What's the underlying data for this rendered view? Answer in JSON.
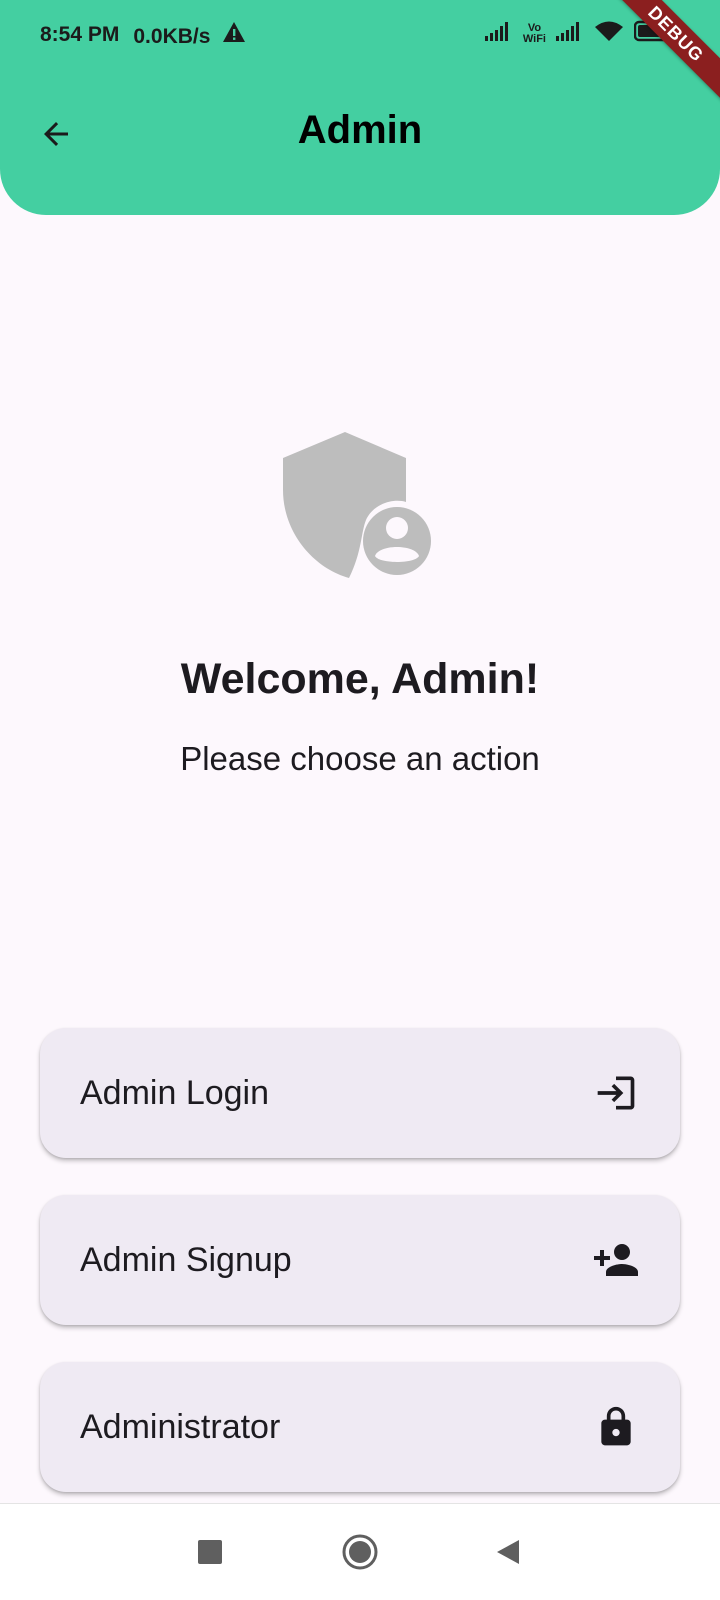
{
  "status_bar": {
    "time": "8:54 PM",
    "network_speed": "0.0KB/s",
    "vowifi_top": "Vo",
    "vowifi_bottom": "WiFi"
  },
  "debug_banner": "DEBUG",
  "appbar": {
    "title": "Admin",
    "back_icon": "arrow-back-icon",
    "color": "#44cfa1"
  },
  "hero": {
    "icon": "admin-shield-person-icon",
    "title": "Welcome, Admin!",
    "subtitle": "Please choose an action"
  },
  "actions": [
    {
      "label": "Admin Login",
      "icon": "login-icon"
    },
    {
      "label": "Admin Signup",
      "icon": "person-add-icon"
    },
    {
      "label": "Administrator",
      "icon": "lock-icon"
    }
  ],
  "nav_bar": {
    "recents_icon": "square-icon",
    "home_icon": "circle-icon",
    "back_icon": "triangle-back-icon"
  },
  "colors": {
    "accent": "#44cfa1",
    "background": "#fdf8fd",
    "card": "#efeaf3"
  }
}
